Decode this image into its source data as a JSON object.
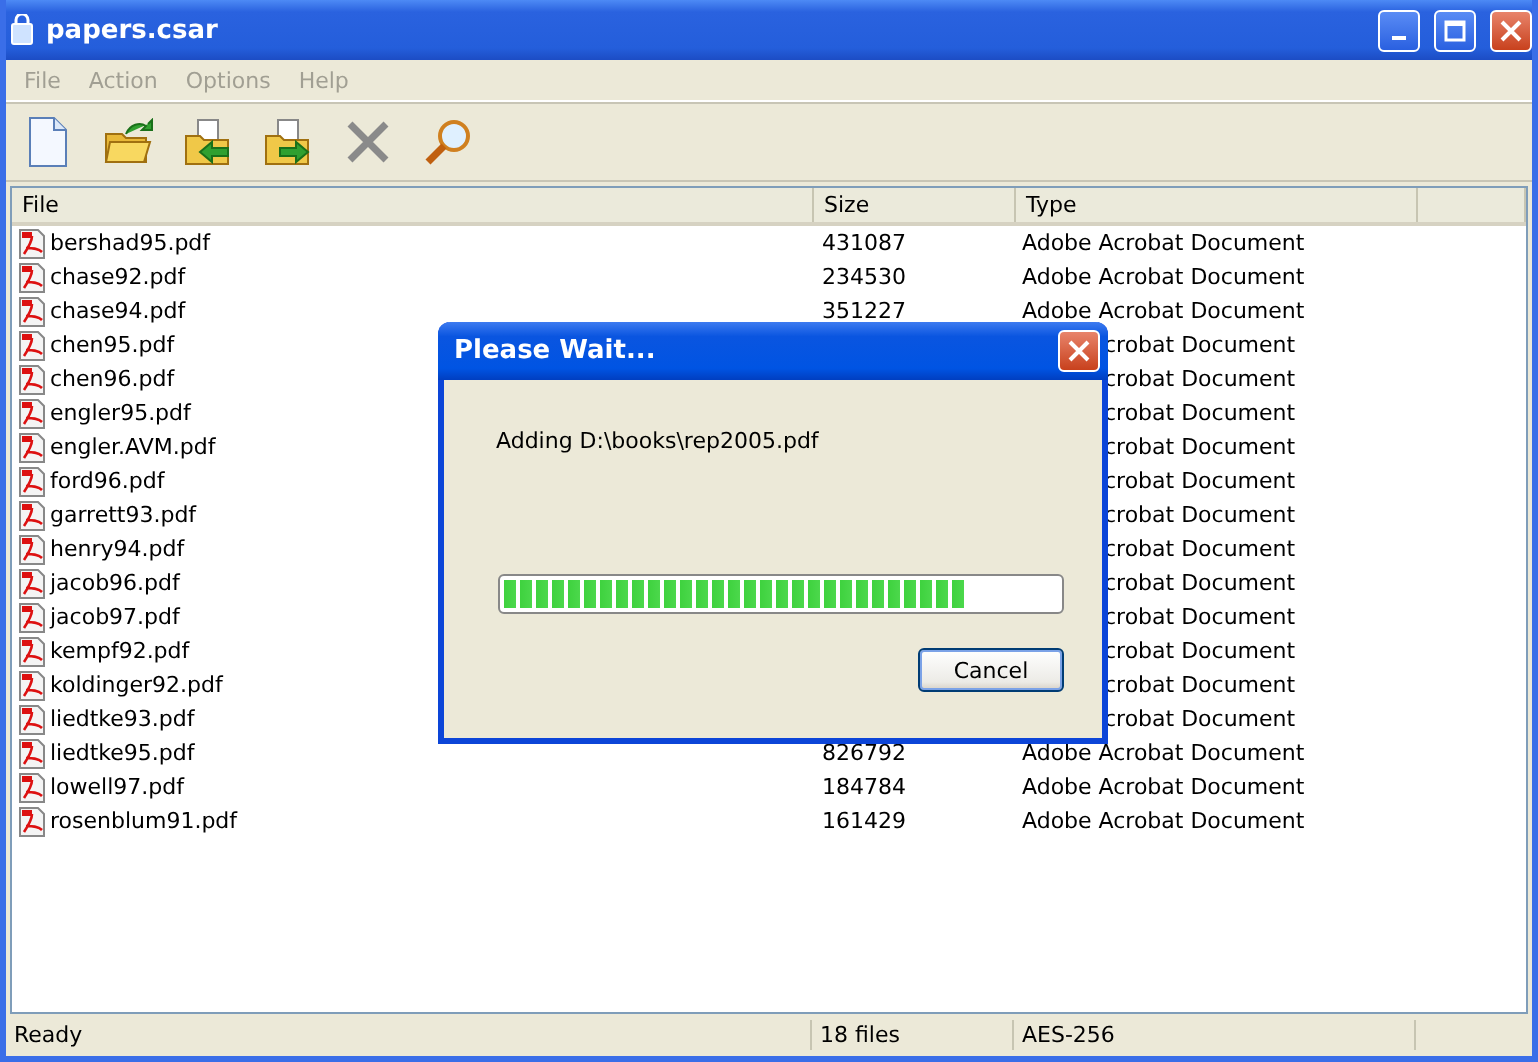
{
  "window": {
    "title": "papers.csar"
  },
  "menu": [
    {
      "label": "File",
      "disabled": true
    },
    {
      "label": "Action",
      "disabled": true
    },
    {
      "label": "Options",
      "disabled": true
    },
    {
      "label": "Help",
      "disabled": true
    }
  ],
  "table": {
    "columns": [
      "File",
      "Size",
      "Type"
    ],
    "rows": [
      {
        "kind": "full",
        "name": "bershad95.pdf",
        "size": "431087",
        "type": "Adobe Acrobat Document"
      },
      {
        "kind": "full",
        "name": "chase92.pdf",
        "size": "234530",
        "type": "Adobe Acrobat Document"
      },
      {
        "kind": "full",
        "name": "chase94.pdf",
        "size": "351227",
        "type": "Adobe Acrobat Document"
      },
      {
        "kind": "covered",
        "name": "chen95.pdf",
        "type": "crobat Document"
      },
      {
        "kind": "covered",
        "name": "chen96.pdf",
        "type": "crobat Document"
      },
      {
        "kind": "covered",
        "name": "engler95.pdf",
        "type": "crobat Document"
      },
      {
        "kind": "covered",
        "name": "engler.AVM.pdf",
        "type": "crobat Document"
      },
      {
        "kind": "covered",
        "name": "ford96.pdf",
        "type": "crobat Document"
      },
      {
        "kind": "covered",
        "name": "garrett93.pdf",
        "type": "crobat Document"
      },
      {
        "kind": "covered",
        "name": "henry94.pdf",
        "type": "crobat Document"
      },
      {
        "kind": "covered",
        "name": "jacob96.pdf",
        "type": "crobat Document"
      },
      {
        "kind": "covered",
        "name": "jacob97.pdf",
        "type": "crobat Document"
      },
      {
        "kind": "covered",
        "name": "kempf92.pdf",
        "type": "crobat Document"
      },
      {
        "kind": "covered",
        "name": "koldinger92.pdf",
        "type": "crobat Document"
      },
      {
        "kind": "covered",
        "name": "liedtke93.pdf",
        "type": "crobat Document"
      },
      {
        "kind": "full",
        "name": "liedtke95.pdf",
        "size": "826792",
        "type": "Adobe Acrobat Document"
      },
      {
        "kind": "full",
        "name": "lowell97.pdf",
        "size": "184784",
        "type": "Adobe Acrobat Document"
      },
      {
        "kind": "full",
        "name": "rosenblum91.pdf",
        "size": "161429",
        "type": "Adobe Acrobat Document"
      }
    ]
  },
  "status_bar": [
    "Ready",
    "18 files",
    "AES-256"
  ],
  "dialog": {
    "title": "Please Wait...",
    "message": "Adding D:\\books\\rep2005.pdf",
    "progress": {
      "level": 0.83
    },
    "buttons": [
      "Cancel"
    ]
  }
}
